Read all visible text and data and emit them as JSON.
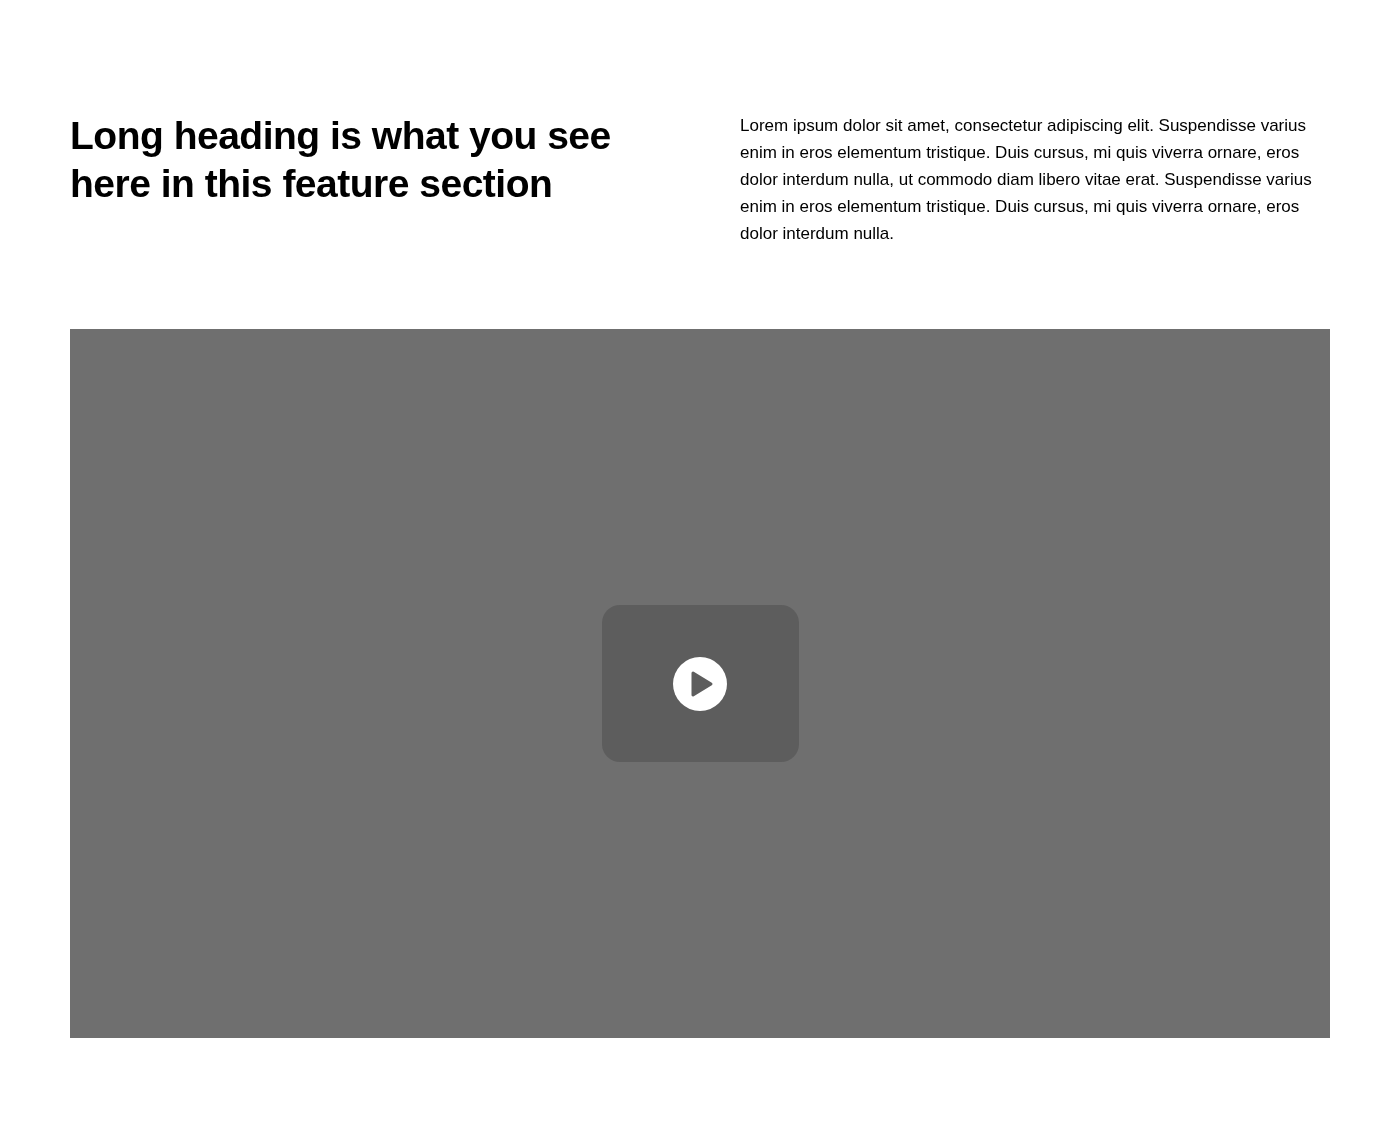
{
  "heading": "Long heading is what you see here in this feature section",
  "body": "Lorem ipsum dolor sit amet, consectetur adipiscing elit. Suspendisse varius enim in eros elementum tristique. Duis cursus, mi quis viverra ornare, eros dolor interdum nulla, ut commodo diam libero vitae erat. Suspendisse varius enim in eros elementum tristique. Duis cursus, mi quis viverra ornare, eros dolor interdum nulla."
}
